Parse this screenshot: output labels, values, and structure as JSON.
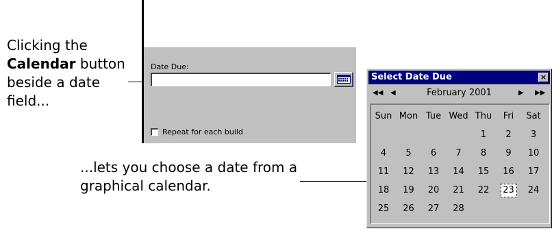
{
  "callouts": {
    "first_prefix": "Clicking the",
    "first_bold": "Calendar",
    "first_suffix": "button beside a date field...",
    "second": "...lets you choose a date from a graphical calendar."
  },
  "panel": {
    "date_due_label": "Date Due:",
    "date_due_value": "",
    "calendar_button_icon": "calendar-icon",
    "repeat_label": "Repeat for each build",
    "repeat_checked": false
  },
  "popup": {
    "title": "Select Date Due",
    "close_glyph": "×",
    "nav_prev_year": "◀◀",
    "nav_prev_month": "◀",
    "nav_next_month": "▶",
    "nav_next_year": "▶▶",
    "month_label": "February 2001",
    "weekdays": [
      "Sun",
      "Mon",
      "Tue",
      "Wed",
      "Thu",
      "Fri",
      "Sat"
    ],
    "weeks": [
      [
        "",
        "",
        "",
        "",
        "1",
        "2",
        "3"
      ],
      [
        "4",
        "5",
        "6",
        "7",
        "8",
        "9",
        "10"
      ],
      [
        "11",
        "12",
        "13",
        "14",
        "15",
        "16",
        "17"
      ],
      [
        "18",
        "19",
        "20",
        "21",
        "22",
        "23",
        "24"
      ],
      [
        "25",
        "26",
        "27",
        "28",
        "",
        "",
        ""
      ]
    ],
    "selected_day": "23"
  },
  "colors": {
    "titlebar": "#000080",
    "face": "#c0c0c0"
  }
}
